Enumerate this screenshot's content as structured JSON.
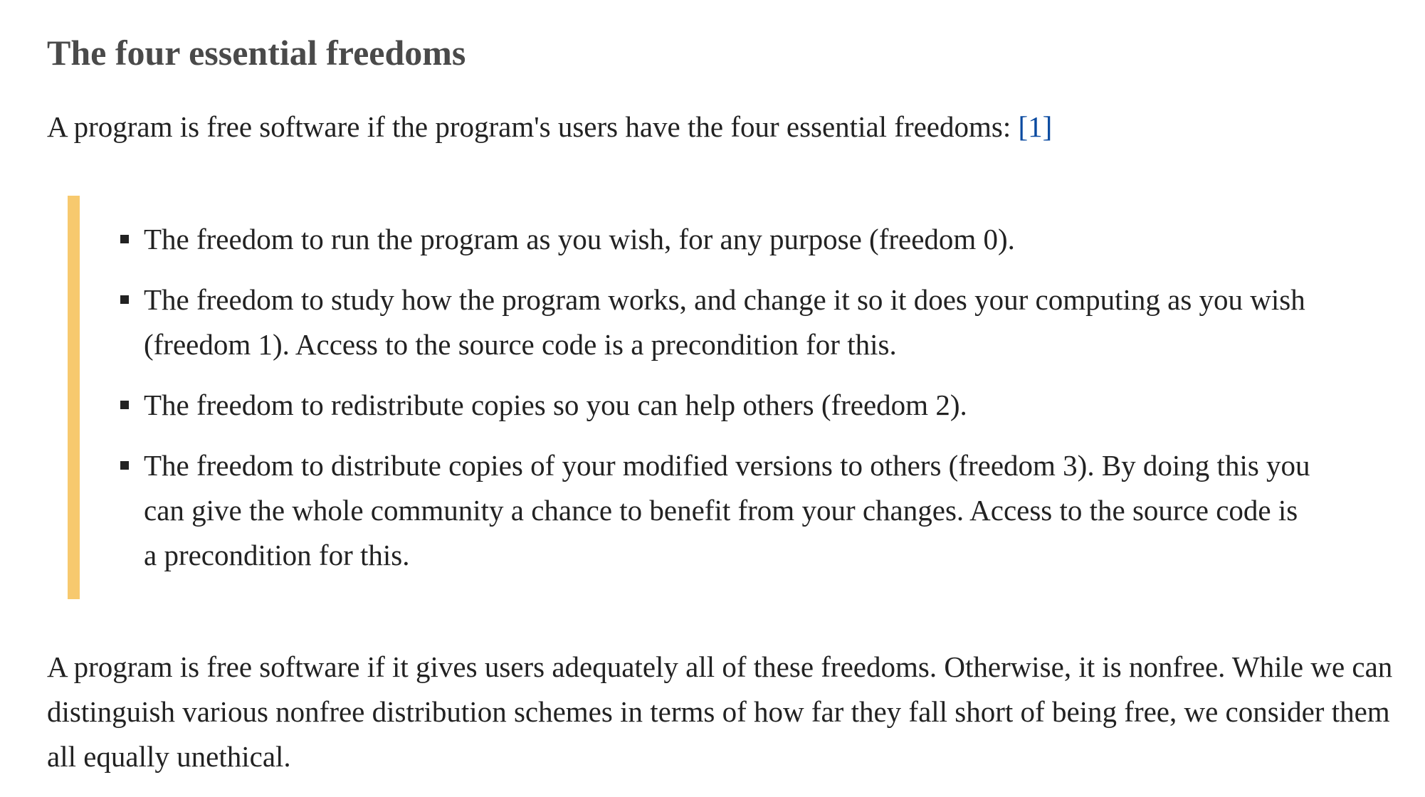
{
  "heading": "The four essential freedoms",
  "intro": {
    "text": "A program is free software if the program's users have the four essential freedoms: ",
    "ref": "[1]"
  },
  "freedoms": [
    "The freedom to run the program as you wish, for any purpose (freedom 0).",
    "The freedom to study how the program works, and change it so it does your computing as you wish (freedom 1). Access to the source code is a precondition for this.",
    "The freedom to redistribute copies so you can help others (freedom 2).",
    "The freedom to distribute copies of your modified versions to others (freedom 3). By doing this you can give the whole community a chance to benefit from your changes. Access to the source code is a precondition for this."
  ],
  "outro": "A program is free software if it gives users adequately all of these freedoms. Otherwise, it is nonfree. While we can distinguish various nonfree distribution schemes in terms of how far they fall short of being free, we consider them all equally unethical.",
  "colors": {
    "quote_bar": "#f7c96e",
    "link": "#0a4aa0",
    "heading": "#4a4a4a",
    "text": "#222222"
  }
}
